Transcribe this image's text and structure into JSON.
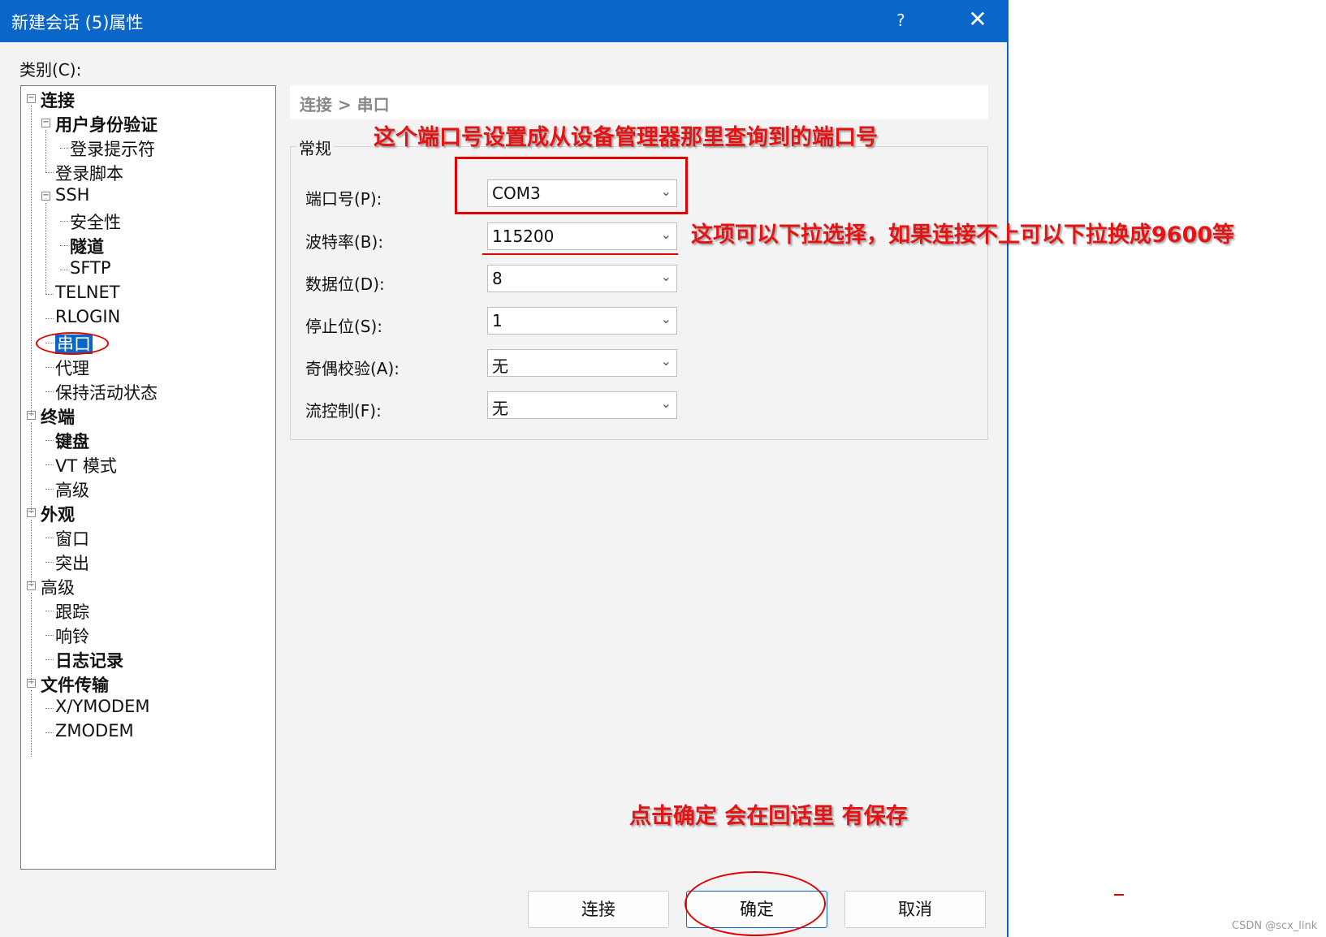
{
  "window": {
    "title": "新建会话 (5)属性",
    "help": "?",
    "close": "✕"
  },
  "category_label": "类别(C):",
  "tree": {
    "items": [
      {
        "label": "连接",
        "level": 0,
        "bold": true,
        "toggle": "⊟"
      },
      {
        "label": "用户身份验证",
        "level": 1,
        "bold": true,
        "toggle": "⊟"
      },
      {
        "label": "登录提示符",
        "level": 2,
        "bold": false
      },
      {
        "label": "登录脚本",
        "level": 1,
        "bold": false
      },
      {
        "label": "SSH",
        "level": 1,
        "bold": false,
        "toggle": "⊟"
      },
      {
        "label": "安全性",
        "level": 2,
        "bold": false
      },
      {
        "label": "隧道",
        "level": 2,
        "bold": true
      },
      {
        "label": "SFTP",
        "level": 2,
        "bold": false
      },
      {
        "label": "TELNET",
        "level": 1,
        "bold": false
      },
      {
        "label": "RLOGIN",
        "level": 1,
        "bold": false
      },
      {
        "label": "串口",
        "level": 1,
        "bold": false,
        "selected": true
      },
      {
        "label": "代理",
        "level": 1,
        "bold": false
      },
      {
        "label": "保持活动状态",
        "level": 1,
        "bold": false
      },
      {
        "label": "终端",
        "level": 0,
        "bold": true,
        "toggle": "⊟"
      },
      {
        "label": "键盘",
        "level": 1,
        "bold": true
      },
      {
        "label": "VT 模式",
        "level": 1,
        "bold": false
      },
      {
        "label": "高级",
        "level": 1,
        "bold": false
      },
      {
        "label": "外观",
        "level": 0,
        "bold": true,
        "toggle": "⊟"
      },
      {
        "label": "窗口",
        "level": 1,
        "bold": false
      },
      {
        "label": "突出",
        "level": 1,
        "bold": false
      },
      {
        "label": "高级",
        "level": 0,
        "bold": false,
        "toggle": "⊟"
      },
      {
        "label": "跟踪",
        "level": 1,
        "bold": false
      },
      {
        "label": "响铃",
        "level": 1,
        "bold": false
      },
      {
        "label": "日志记录",
        "level": 1,
        "bold": true
      },
      {
        "label": "文件传输",
        "level": 0,
        "bold": true,
        "toggle": "⊟"
      },
      {
        "label": "X/YMODEM",
        "level": 1,
        "bold": false
      },
      {
        "label": "ZMODEM",
        "level": 1,
        "bold": false
      }
    ]
  },
  "breadcrumb": "连接 > 串口",
  "group_title": "常规",
  "fields": [
    {
      "label": "端口号(P):",
      "value": "COM3"
    },
    {
      "label": "波特率(B):",
      "value": "115200"
    },
    {
      "label": "数据位(D):",
      "value": "8"
    },
    {
      "label": "停止位(S):",
      "value": "1"
    },
    {
      "label": "奇偶校验(A):",
      "value": "无"
    },
    {
      "label": "流控制(F):",
      "value": "无"
    }
  ],
  "buttons": {
    "connect": "连接",
    "ok": "确定",
    "cancel": "取消"
  },
  "annotations": {
    "port_note": "这个端口号设置成从设备管理器那里查询到的端口号",
    "baud_note": "这项可以下拉选择，如果连接不上可以下拉换成9600等",
    "ok_note": "点击确定 会在回话里 有保存",
    "color": "#e41414"
  },
  "watermark": "CSDN @scx_link",
  "colors": {
    "titlebar": "#0a66c8",
    "selection": "#0a66c8"
  }
}
